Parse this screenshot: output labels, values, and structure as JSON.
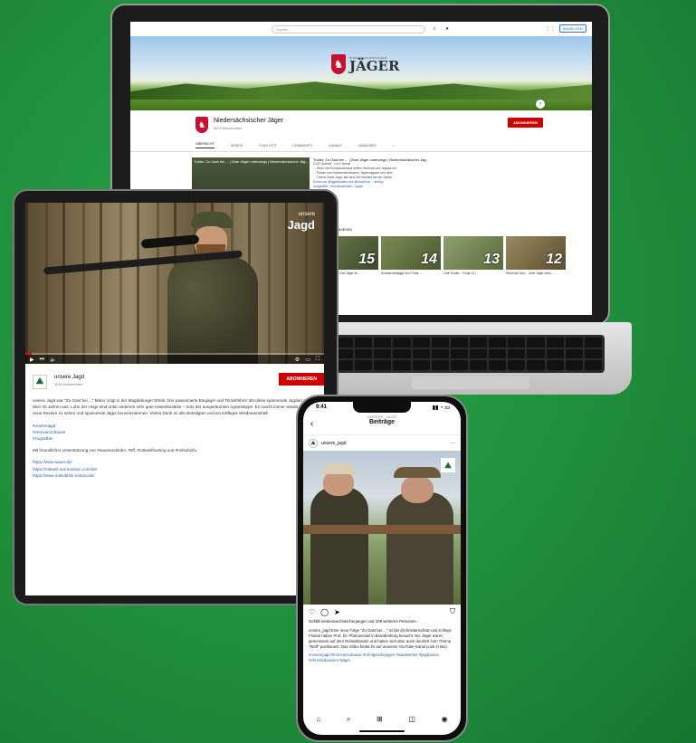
{
  "colors": {
    "background": "#23993f",
    "subscribe_red": "#cc0000",
    "jaeger_red": "#c8102e",
    "link_blue": "#2a5db0"
  },
  "laptop": {
    "search_placeholder": "Suchen",
    "signin_label": "ANMELDEN",
    "banner": {
      "small_text": "NIEDERSÄCHSISCHER",
      "big_text": "JÄGER"
    },
    "channel": {
      "name": "Niedersächsischer Jäger",
      "subscribers": "4670 Abonnenten",
      "subscribe_label": "ABONNIEREN"
    },
    "tabs": [
      "ÜBERSICHT",
      "VIDEOS",
      "PLAYLISTS",
      "COMMUNITY",
      "KANÄLE",
      "KANALINFO"
    ],
    "featured": {
      "thumb_title": "Trailer: Zu Gast bei ... | Zwei Jäger unterwegs | Niedersächsische Jäg...",
      "title": "Trailer: Zu Gast bei ... | Zwei Jäger unterwegs | Niedersächsischer Jäg...",
      "meta": "4.427 Aufrufe · vor 1 Monat",
      "lines": [
        "... Ohne viel Schnickschnack treffen Gerlinde und Jessica mit",
        "... Florian vom Niedersächsischen Jägermagazin und dem",
        "... Thema Zweit-Jagd, alle sind mit Herzblut bei der Sache",
        "Schau bei @agjschladen und @lzms/lhub ... fleißig!",
        "#zugastbei · #niedersachsen · #jagd"
      ]
    },
    "shelf_title": "ALLE FOLGEN ANSEHEN",
    "cards": [
      {
        "number": "15",
        "title": "Zu Gast bei... | Drei Jäger im ..."
      },
      {
        "number": "14",
        "title": "Schwarzwildjagd mit 3 Paar ..."
      },
      {
        "number": "13",
        "title": "Lore Kohler... Folge 13 | ..."
      },
      {
        "number": "12",
        "title": "Reinhold Zerp... Zwei Jäger beim ..."
      }
    ]
  },
  "tablet": {
    "brand": {
      "small": "unsere",
      "big": "Jagd"
    },
    "progress_fraction": 0.02,
    "channel": {
      "name": "unsere Jagd",
      "subscribers": "3030 Abonnenten",
      "subscribe_label": "ABONNIEREN"
    },
    "description": "unsere Jagd war \"Zu Gast bei ...\" Mario Voigt in der Magdeburger Börde. Der passionierte Baujäger und Teckelführer übt diese spannende Jagdart seit über 20 Jahren aus. Lohn der Hege sind unter anderem sehr gute Hasenbesätze – trotz der ausgeräumten Agrarsteppe. Es macht immer wieder Freude, neue Reviere zu sehen und spannende Jäger kennenzulernen. Vielen Dank an alle Beteiligten und ein kräftiges Weidmannsheil!",
    "hashtags": [
      "#unserejagd",
      "#imrevierzuhause",
      "#zugastbei"
    ],
    "support": "Mit freundlicher Unterstützung von #sauerundsohn, #sff, #rottweilhunting und #mitsubishi.",
    "links": [
      "https://www.sauer.de/",
      "https://rottweil-ammunition.com/de/",
      "https://www.mitsubishi-motors.de/"
    ]
  },
  "phone": {
    "time": "9:41",
    "header_user": "UNSERE_JAGD",
    "header_title": "Beiträge",
    "post_user": "unsere_jagd",
    "likes": "Gefällt niedersaechsischerjaeger und 109 weiteren Personen",
    "caption": "unsere_jagd Eine neue Folge \"Zu Gast bei ...\" ist da! @christianschatz und Kollege Florian haben Prof. Dr. Pfannenstiel in Brandenburg besucht. Die Jäger waren gemeinsam auf dem Rehwildansitz und haben sich aber auch deutlich zum Thema \"Wolf\" positioniert. Das Video findet ihr auf unserem YouTube-Kanal (Link in Bio).",
    "hashtags": "#unserejagd #imrevierzuhause #erfolgreichejagen #waidwerker #jagdpraxis #ehrentedossiers #jäger"
  }
}
